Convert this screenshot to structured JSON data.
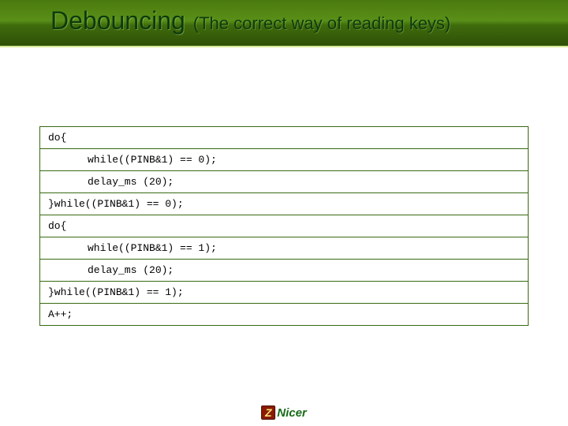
{
  "header": {
    "title": "Debouncing",
    "subtitle": "(The correct way of reading keys)"
  },
  "code": {
    "lines": [
      {
        "text": "do{",
        "indent": false
      },
      {
        "text": "while((PINB&1) == 0);",
        "indent": true
      },
      {
        "text": "delay_ms (20);",
        "indent": true
      },
      {
        "text": "}while((PINB&1) == 0);",
        "indent": false
      },
      {
        "text": "do{",
        "indent": false
      },
      {
        "text": "while((PINB&1) == 1);",
        "indent": true
      },
      {
        "text": "delay_ms (20);",
        "indent": true
      },
      {
        "text": "}while((PINB&1) == 1);",
        "indent": false
      },
      {
        "text": "A++;",
        "indent": false
      }
    ]
  },
  "footer": {
    "logo_z": "Z",
    "logo_text": "Nicer"
  }
}
